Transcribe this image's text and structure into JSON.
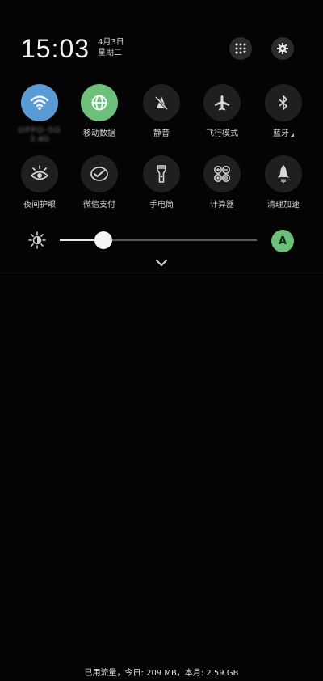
{
  "status": {
    "time": "15:03",
    "date": "4月3日",
    "weekday": "星期二"
  },
  "tiles_row1": [
    {
      "label": "OPPO-5G",
      "sub": "2.4G",
      "icon": "wifi-icon",
      "active": true
    },
    {
      "label": "移动数据",
      "icon": "globe-icon",
      "active": true
    },
    {
      "label": "静音",
      "icon": "mute-icon",
      "active": false
    },
    {
      "label": "飞行模式",
      "icon": "airplane-icon",
      "active": false
    },
    {
      "label": "蓝牙",
      "icon": "bluetooth-icon",
      "active": false
    }
  ],
  "tiles_row2": [
    {
      "label": "夜间护眼",
      "icon": "eye-icon"
    },
    {
      "label": "微信支付",
      "icon": "wechat-pay-icon"
    },
    {
      "label": "手电筒",
      "icon": "flashlight-icon"
    },
    {
      "label": "计算器",
      "icon": "calculator-icon"
    },
    {
      "label": "清理加速",
      "icon": "rocket-icon"
    }
  ],
  "brightness": {
    "level": 0.22,
    "auto_label": "A"
  },
  "footer": {
    "data_usage": "已用流量，今日: 209 MB，本月: 2.59 GB"
  },
  "colors": {
    "wifi_active": "#5b9bd5",
    "data_active": "#6cc07a",
    "tile_inactive": "#1f1f1f"
  }
}
